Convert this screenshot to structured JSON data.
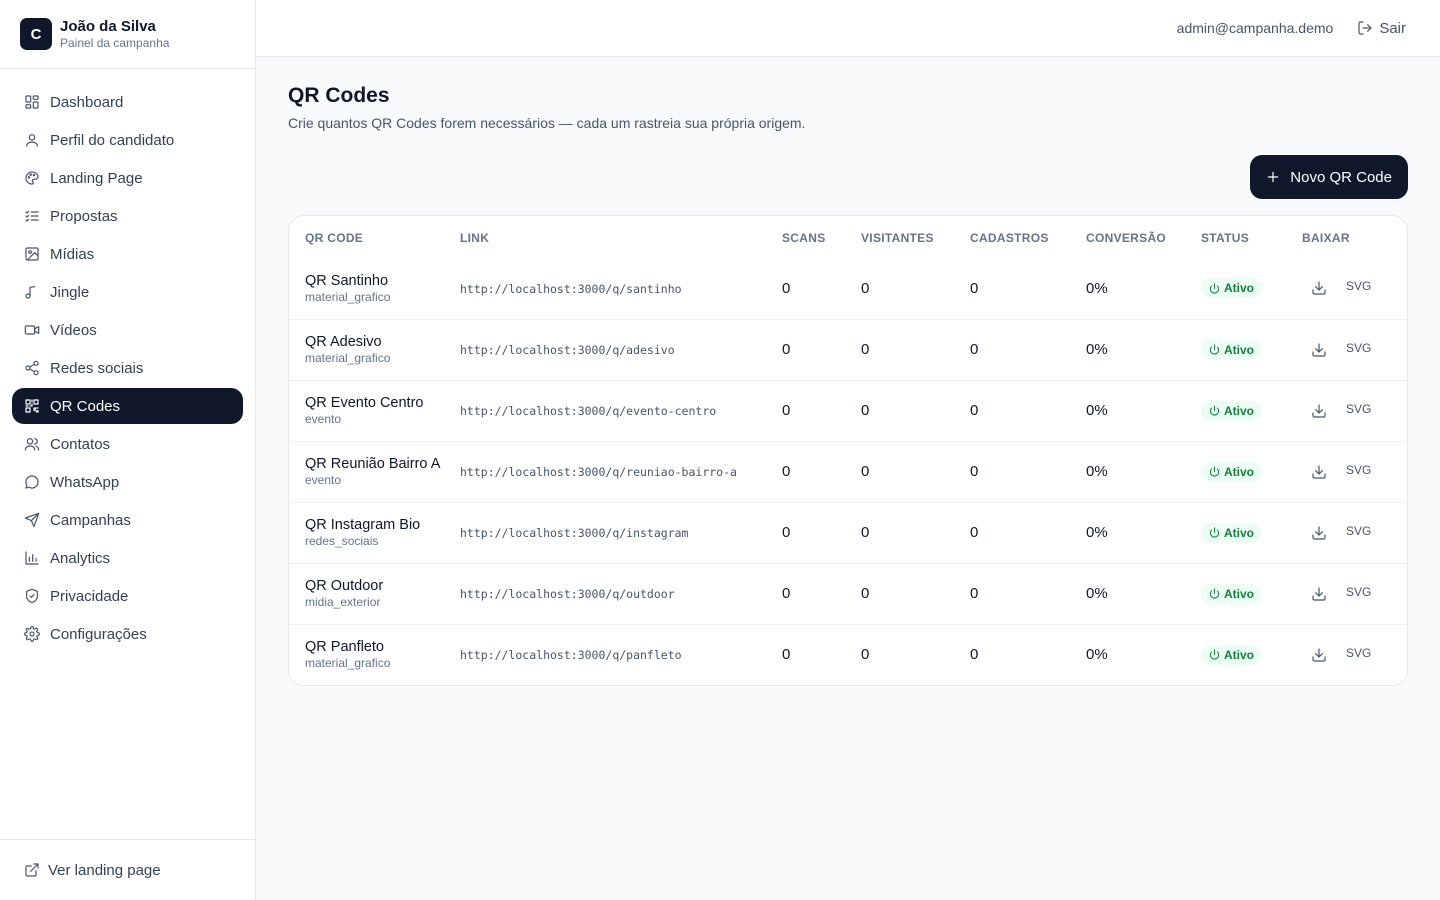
{
  "brand": {
    "logo_letter": "C",
    "name": "João da Silva",
    "subtitle": "Painel da campanha"
  },
  "sidebar": {
    "items": [
      {
        "label": "Dashboard",
        "icon": "dashboard-icon"
      },
      {
        "label": "Perfil do candidato",
        "icon": "user-icon"
      },
      {
        "label": "Landing Page",
        "icon": "palette-icon"
      },
      {
        "label": "Propostas",
        "icon": "list-check-icon"
      },
      {
        "label": "Mídias",
        "icon": "image-icon"
      },
      {
        "label": "Jingle",
        "icon": "music-icon"
      },
      {
        "label": "Vídeos",
        "icon": "video-icon"
      },
      {
        "label": "Redes sociais",
        "icon": "share-icon"
      },
      {
        "label": "QR Codes",
        "icon": "qr-icon",
        "active": true
      },
      {
        "label": "Contatos",
        "icon": "users-icon"
      },
      {
        "label": "WhatsApp",
        "icon": "chat-icon"
      },
      {
        "label": "Campanhas",
        "icon": "send-icon"
      },
      {
        "label": "Analytics",
        "icon": "bar-chart-icon"
      },
      {
        "label": "Privacidade",
        "icon": "shield-icon"
      },
      {
        "label": "Configurações",
        "icon": "gear-icon"
      }
    ],
    "footer_link": "Ver landing page"
  },
  "topbar": {
    "email": "admin@campanha.demo",
    "logout_label": "Sair"
  },
  "page": {
    "title": "QR Codes",
    "subtitle": "Crie quantos QR Codes forem necessários — cada um rastreia sua própria origem.",
    "new_button": "Novo QR Code"
  },
  "table": {
    "columns": [
      "QR CODE",
      "LINK",
      "SCANS",
      "VISITANTES",
      "CADASTROS",
      "CONVERSÃO",
      "STATUS",
      "BAIXAR"
    ],
    "rows": [
      {
        "name": "QR Santinho",
        "type": "material_grafico",
        "link": "http://localhost:3000/q/santinho",
        "scans": "0",
        "visitantes": "0",
        "cadastros": "0",
        "conversao": "0%",
        "status": "Ativo",
        "download": "SVG"
      },
      {
        "name": "QR Adesivo",
        "type": "material_grafico",
        "link": "http://localhost:3000/q/adesivo",
        "scans": "0",
        "visitantes": "0",
        "cadastros": "0",
        "conversao": "0%",
        "status": "Ativo",
        "download": "SVG"
      },
      {
        "name": "QR Evento Centro",
        "type": "evento",
        "link": "http://localhost:3000/q/evento-centro",
        "scans": "0",
        "visitantes": "0",
        "cadastros": "0",
        "conversao": "0%",
        "status": "Ativo",
        "download": "SVG"
      },
      {
        "name": "QR Reunião Bairro A",
        "type": "evento",
        "link": "http://localhost:3000/q/reuniao-bairro-a",
        "scans": "0",
        "visitantes": "0",
        "cadastros": "0",
        "conversao": "0%",
        "status": "Ativo",
        "download": "SVG"
      },
      {
        "name": "QR Instagram Bio",
        "type": "redes_sociais",
        "link": "http://localhost:3000/q/instagram",
        "scans": "0",
        "visitantes": "0",
        "cadastros": "0",
        "conversao": "0%",
        "status": "Ativo",
        "download": "SVG"
      },
      {
        "name": "QR Outdoor",
        "type": "midia_exterior",
        "link": "http://localhost:3000/q/outdoor",
        "scans": "0",
        "visitantes": "0",
        "cadastros": "0",
        "conversao": "0%",
        "status": "Ativo",
        "download": "SVG"
      },
      {
        "name": "QR Panfleto",
        "type": "material_grafico",
        "link": "http://localhost:3000/q/panfleto",
        "scans": "0",
        "visitantes": "0",
        "cadastros": "0",
        "conversao": "0%",
        "status": "Ativo",
        "download": "SVG"
      }
    ]
  },
  "colors": {
    "primary": "#0f172a",
    "status_bg": "#ecfdf3",
    "status_text": "#15803d"
  }
}
